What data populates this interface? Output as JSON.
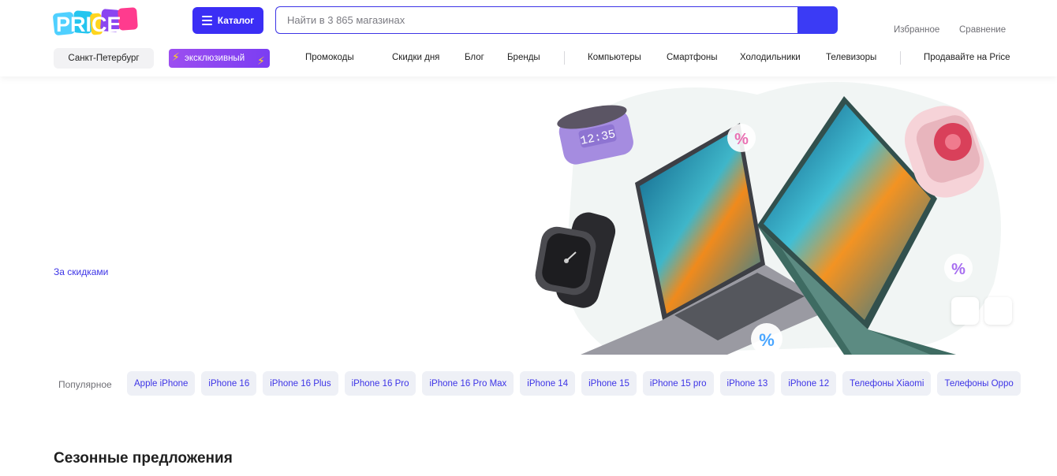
{
  "header": {
    "logo_text": "PRICE",
    "catalog_label": "Каталог",
    "search": {
      "placeholder": "Найти в 3 865 магазинах",
      "value": ""
    },
    "links": {
      "favorites": "Избранное",
      "compare": "Сравнение"
    }
  },
  "subnav": {
    "city": "Санкт-Петербург",
    "exclusive_badge": "эксклюзивный",
    "links": [
      "Промокоды",
      "Скидки дня",
      "Блог",
      "Бренды"
    ],
    "categories": [
      "Компьютеры",
      "Смартфоны",
      "Холодильники",
      "Телевизоры"
    ],
    "sell_link": "Продавайте на Price"
  },
  "hero": {
    "promo_link": "За скидками",
    "speaker_clock": "12:35"
  },
  "popular": {
    "label": "Популярное",
    "chips": [
      "Apple iPhone",
      "iPhone 16",
      "iPhone 16 Plus",
      "iPhone 16 Pro",
      "iPhone 16 Pro Max",
      "iPhone 14",
      "iPhone 15",
      "iPhone 15 pro",
      "iPhone 13",
      "iPhone 12",
      "Телефоны Xiaomi",
      "Телефоны Oppo"
    ]
  },
  "section": {
    "title": "Сезонные предложения"
  },
  "colors": {
    "accent": "#3b2ef5",
    "link": "#3d34e6",
    "chip_bg": "#eef0f6",
    "badge": "#8b45f0",
    "bolt": "#ffd51f"
  },
  "icons": [
    "burger-icon",
    "search-icon",
    "lightning-icon",
    "percent-icon"
  ]
}
